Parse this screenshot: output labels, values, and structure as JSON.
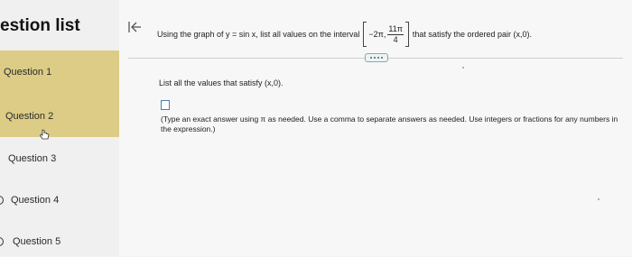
{
  "sidebar": {
    "title": "estion list",
    "questions": [
      {
        "label": "Question 1",
        "active": true
      },
      {
        "label": "Question 2",
        "active": true
      },
      {
        "label": "Question 3",
        "active": false
      },
      {
        "label": "Question 4",
        "active": false
      },
      {
        "label": "Question 5",
        "active": false
      }
    ]
  },
  "header": {
    "prompt_before": "Using the graph of y = sin x, list all values on the interval",
    "interval_left": "−2π,",
    "interval_num": "11π",
    "interval_den": "4",
    "prompt_after": "that satisfy the ordered pair (x,0).",
    "collapse_icon": "arrow-left-bar-icon"
  },
  "main": {
    "instruction": "List all the values that satisfy (x,0).",
    "answer_value": "",
    "hint": "(Type an exact answer using π as needed. Use a comma to separate answers as needed. Use integers or fractions for any numbers in the expression.)"
  },
  "colors": {
    "active_question_bg": "#dccc86",
    "answer_border": "#4a7fb5"
  }
}
